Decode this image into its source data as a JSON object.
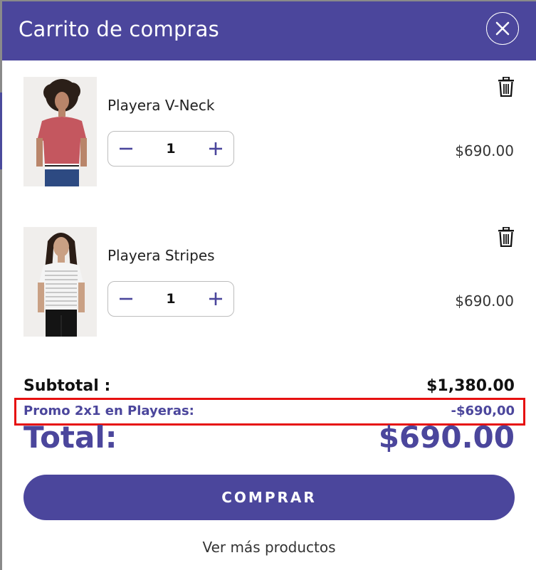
{
  "header": {
    "title": "Carrito de compras"
  },
  "items": [
    {
      "name": "Playera V-Neck",
      "quantity": "1",
      "price": "$690.00",
      "shirt_color": "#c4575f"
    },
    {
      "name": "Playera Stripes",
      "quantity": "1",
      "price": "$690.00",
      "shirt_color": "#f3f3f3"
    }
  ],
  "summary": {
    "subtotal_label": "Subtotal :",
    "subtotal_value": "$1,380.00",
    "promo_label": "Promo 2x1 en Playeras:",
    "promo_value": "-$690,00",
    "total_label": "Total:",
    "total_value": "$690.00"
  },
  "buy_button": "COMPRAR",
  "more_link": "Ver más productos",
  "colors": {
    "accent": "#4b469c",
    "highlight": "#e61010"
  }
}
